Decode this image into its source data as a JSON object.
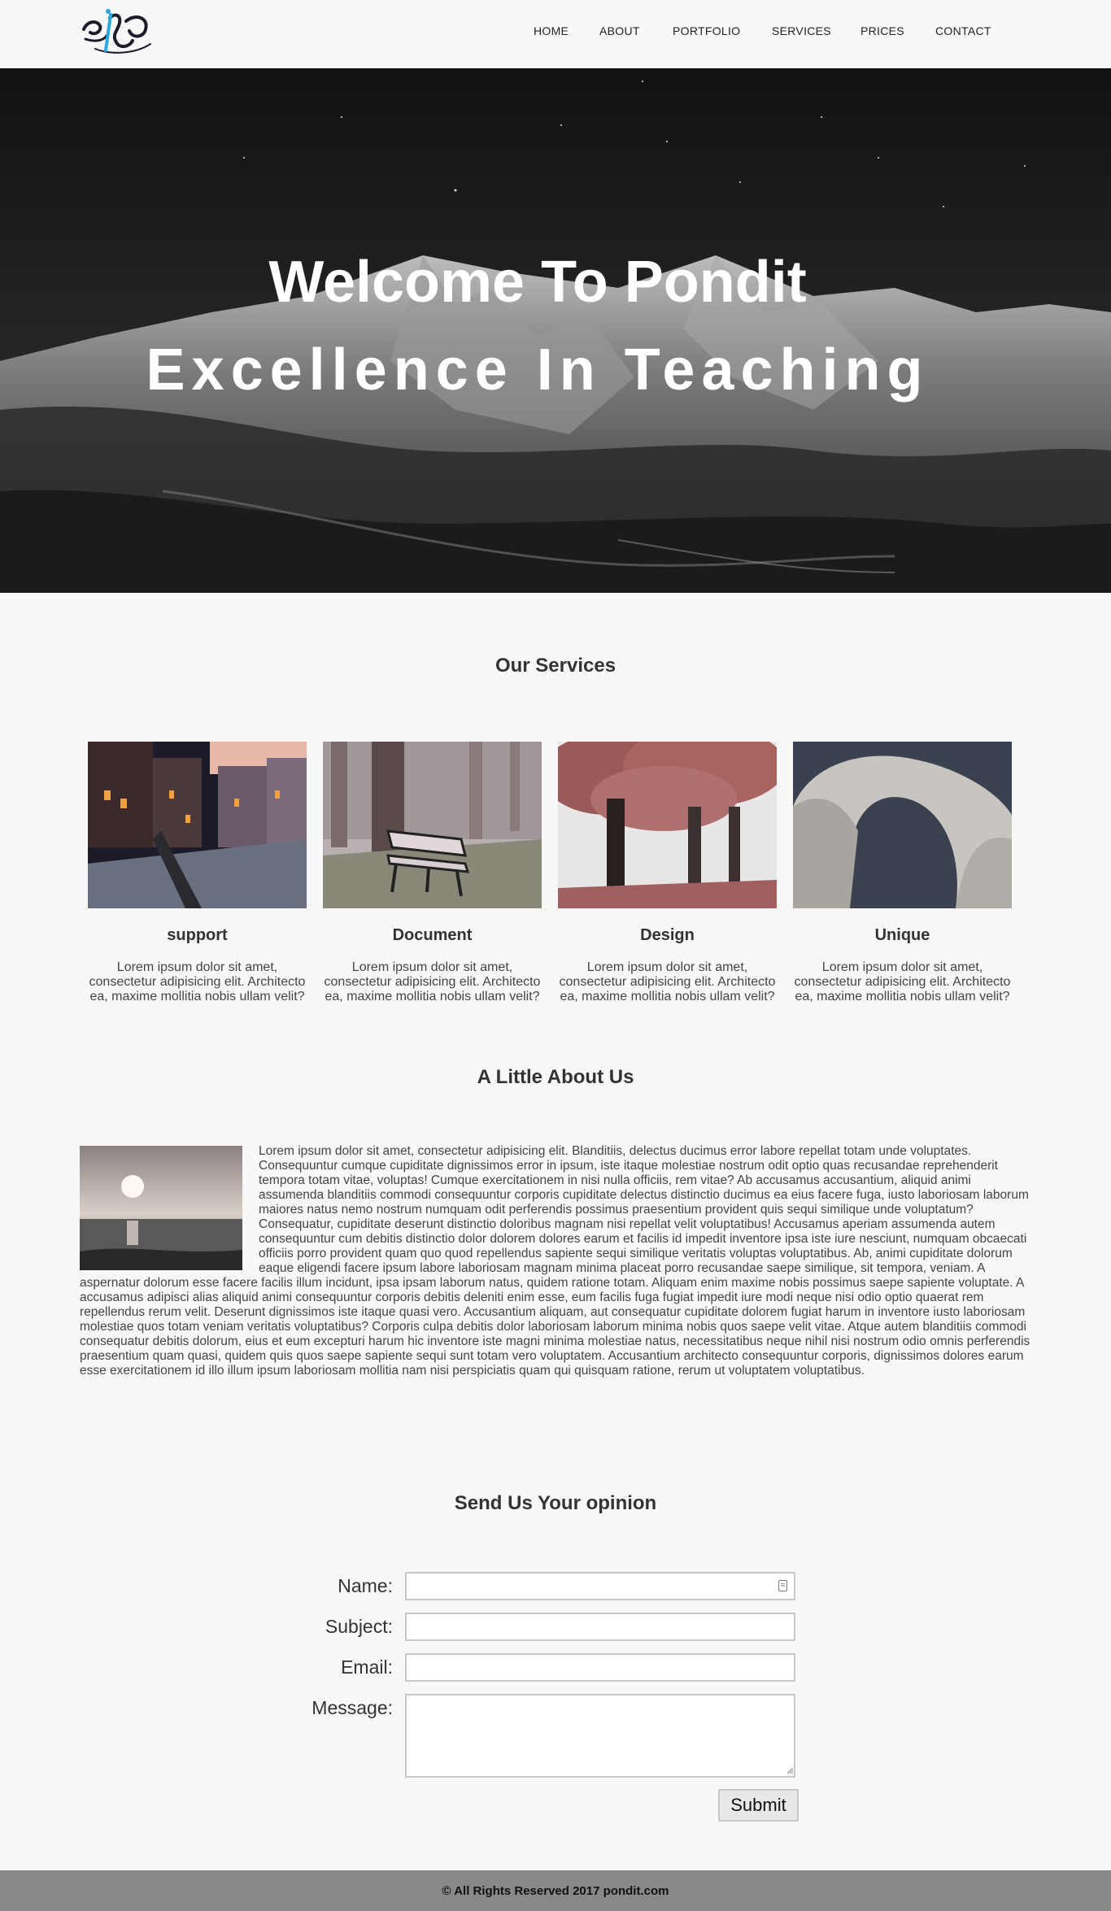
{
  "header": {
    "logo_text": "পণ্ডিত",
    "nav": [
      "HOME",
      "ABOUT",
      "PORTFOLIO",
      "SERVICES",
      "PRICES",
      "CONTACT"
    ]
  },
  "hero": {
    "title": "Welcome To Pondit",
    "subtitle": "Excellence In Teaching"
  },
  "services": {
    "title": "Our Services",
    "items": [
      {
        "title": "support",
        "text": "Lorem ipsum dolor sit amet, consectetur adipisicing elit. Architecto ea, maxime mollitia nobis ullam velit?"
      },
      {
        "title": "Document",
        "text": "Lorem ipsum dolor sit amet, consectetur adipisicing elit. Architecto ea, maxime mollitia nobis ullam velit?"
      },
      {
        "title": "Design",
        "text": "Lorem ipsum dolor sit amet, consectetur adipisicing elit. Architecto ea, maxime mollitia nobis ullam velit?"
      },
      {
        "title": "Unique",
        "text": "Lorem ipsum dolor sit amet, consectetur adipisicing elit. Architecto ea, maxime mollitia nobis ullam velit?"
      }
    ]
  },
  "about": {
    "title": "A Little About Us",
    "text": "Lorem ipsum dolor sit amet, consectetur adipisicing elit. Blanditiis, delectus ducimus error labore repellat totam unde voluptates. Consequuntur cumque cupiditate dignissimos error in ipsum, iste itaque molestiae nostrum odit optio quas recusandae reprehenderit tempora totam vitae, voluptas! Cumque exercitationem in nisi nulla officiis, rem vitae? Ab accusamus accusantium, aliquid animi assumenda blanditiis commodi consequuntur corporis cupiditate delectus distinctio ducimus ea eius facere fuga, iusto laboriosam laborum maiores natus nemo nostrum numquam odit perferendis possimus praesentium provident quis sequi similique unde voluptatum? Consequatur, cupiditate deserunt distinctio doloribus magnam nisi repellat velit voluptatibus! Accusamus aperiam assumenda autem consequuntur cum debitis distinctio dolor dolorem dolores earum et facilis id impedit inventore ipsa iste iure nesciunt, numquam obcaecati officiis porro provident quam quo quod repellendus sapiente sequi similique veritatis voluptas voluptatibus. Ab, animi cupiditate dolorum eaque eligendi facere ipsum labore laboriosam magnam minima placeat porro recusandae saepe similique, sit tempora, veniam. A aspernatur dolorum esse facere facilis illum incidunt, ipsa ipsam laborum natus, quidem ratione totam. Aliquam enim maxime nobis possimus saepe sapiente voluptate. A accusamus adipisci alias aliquid animi consequuntur corporis debitis deleniti enim esse, eum facilis fuga fugiat impedit iure modi neque nisi odio optio quaerat rem repellendus rerum velit. Deserunt dignissimos iste itaque quasi vero. Accusantium aliquam, aut consequatur cupiditate dolorem fugiat harum in inventore iusto laboriosam molestiae quos totam veniam veritatis voluptatibus? Corporis culpa debitis dolor laboriosam laborum minima nobis quos saepe velit vitae. Atque autem blanditiis commodi consequatur debitis dolorum, eius et eum excepturi harum hic inventore iste magni minima molestiae natus, necessitatibus neque nihil nisi nostrum odio omnis perferendis praesentium quam quasi, quidem quis quos saepe sapiente sequi sunt totam vero voluptatem. Accusantium architecto consequuntur corporis, dignissimos dolores earum esse exercitationem id illo illum ipsum laboriosam mollitia nam nisi perspiciatis quam qui quisquam ratione, rerum ut voluptatem voluptatibus."
  },
  "contact": {
    "title": "Send Us Your opinion",
    "labels": {
      "name": "Name:",
      "subject": "Subject:",
      "email": "Email:",
      "message": "Message:"
    },
    "values": {
      "name": "",
      "subject": "",
      "email": "",
      "message": ""
    },
    "submit": "Submit"
  },
  "footer": {
    "text": "© All Rights Reserved 2017 pondit.com"
  },
  "colors": {
    "page_bg": "#f8f8f8",
    "footer_bg": "#888888",
    "hero_overlay": "#1a1a1a",
    "text": "#333333"
  }
}
